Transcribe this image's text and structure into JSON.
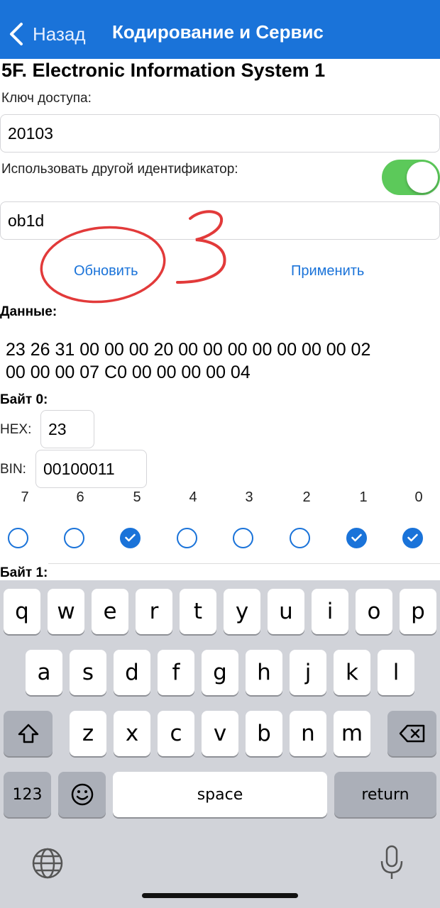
{
  "navbar": {
    "back_label": "Назад",
    "title": "Кодирование и Сервис",
    "color": "#1a73d9"
  },
  "system_title": "5F. Electronic Information System 1",
  "access_key": {
    "label": "Ключ доступа:",
    "value": "20103"
  },
  "alt_id": {
    "label": "Использовать другой идентификатор:",
    "toggle_on": true,
    "value": "ob1d"
  },
  "actions": {
    "refresh": "Обновить",
    "apply": "Применить"
  },
  "annotation_number": "3",
  "data_section": {
    "label": "Данные:",
    "line1": "23 26 31 00 00 00 20 00 00 00 00 00 00 00 02",
    "line2": "00 00 00 07 C0 00 00 00 00 04"
  },
  "byte0": {
    "label": "Байт 0:",
    "hex_label": "HEX:",
    "hex_value": "23",
    "bin_label": "BIN:",
    "bin_value": "00100011",
    "bits": [
      {
        "num": "7",
        "checked": false
      },
      {
        "num": "6",
        "checked": false
      },
      {
        "num": "5",
        "checked": true
      },
      {
        "num": "4",
        "checked": false
      },
      {
        "num": "3",
        "checked": false
      },
      {
        "num": "2",
        "checked": false
      },
      {
        "num": "1",
        "checked": true
      },
      {
        "num": "0",
        "checked": true
      }
    ]
  },
  "byte1": {
    "label": "Байт 1:"
  },
  "keyboard": {
    "row1": [
      "q",
      "w",
      "e",
      "r",
      "t",
      "y",
      "u",
      "i",
      "o",
      "p"
    ],
    "row2": [
      "a",
      "s",
      "d",
      "f",
      "g",
      "h",
      "j",
      "k",
      "l"
    ],
    "row3": [
      "z",
      "x",
      "c",
      "v",
      "b",
      "n",
      "m"
    ],
    "numbers_label": "123",
    "space_label": "space",
    "return_label": "return",
    "icons": [
      "shift-icon",
      "backspace-icon",
      "emoji-icon",
      "globe-icon",
      "microphone-icon"
    ]
  }
}
